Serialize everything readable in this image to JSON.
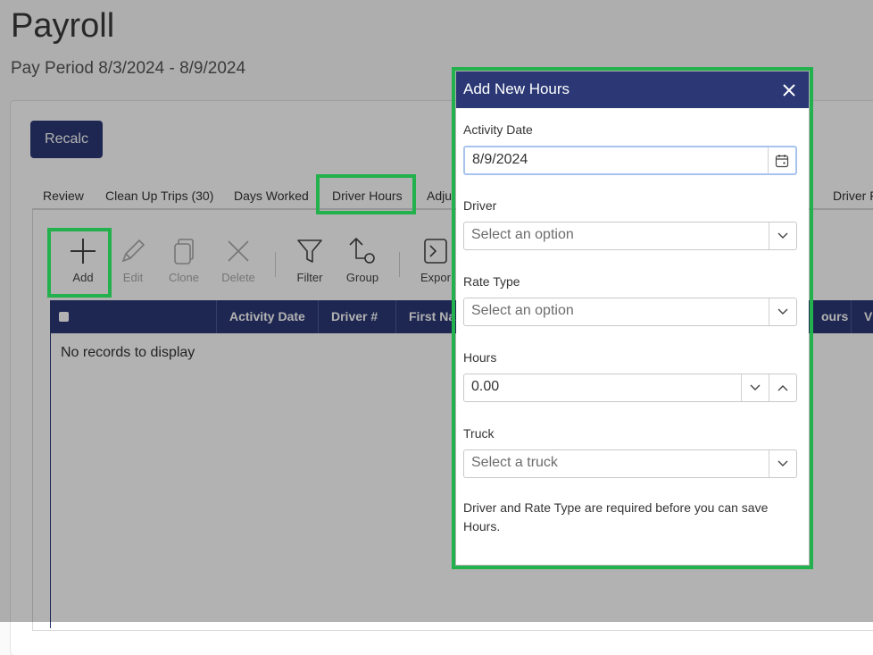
{
  "page": {
    "title": "Payroll",
    "pay_period": "Pay Period 8/3/2024 - 8/9/2024"
  },
  "recalc_label": "Recalc",
  "tabs": [
    "Review",
    "Clean Up Trips (30)",
    "Days Worked",
    "Driver Hours",
    "Adju",
    "Driver F"
  ],
  "toolbar": {
    "add": "Add",
    "edit": "Edit",
    "clone": "Clone",
    "delete": "Delete",
    "filter": "Filter",
    "group": "Group",
    "export": "Expor"
  },
  "grid": {
    "columns": [
      "Activity Date",
      "Driver #",
      "First Na",
      "ours",
      "V"
    ],
    "empty_text": "No records to display"
  },
  "modal": {
    "title": "Add New Hours",
    "activity_date_label": "Activity Date",
    "activity_date_value": "8/9/2024",
    "driver_label": "Driver",
    "driver_placeholder": "Select an option",
    "rate_type_label": "Rate Type",
    "rate_type_placeholder": "Select an option",
    "hours_label": "Hours",
    "hours_value": "0.00",
    "truck_label": "Truck",
    "truck_placeholder": "Select a truck",
    "note": "Driver and Rate Type are required before you can save Hours."
  },
  "colors": {
    "primary": "#2b3875",
    "highlight": "#22b14c"
  }
}
